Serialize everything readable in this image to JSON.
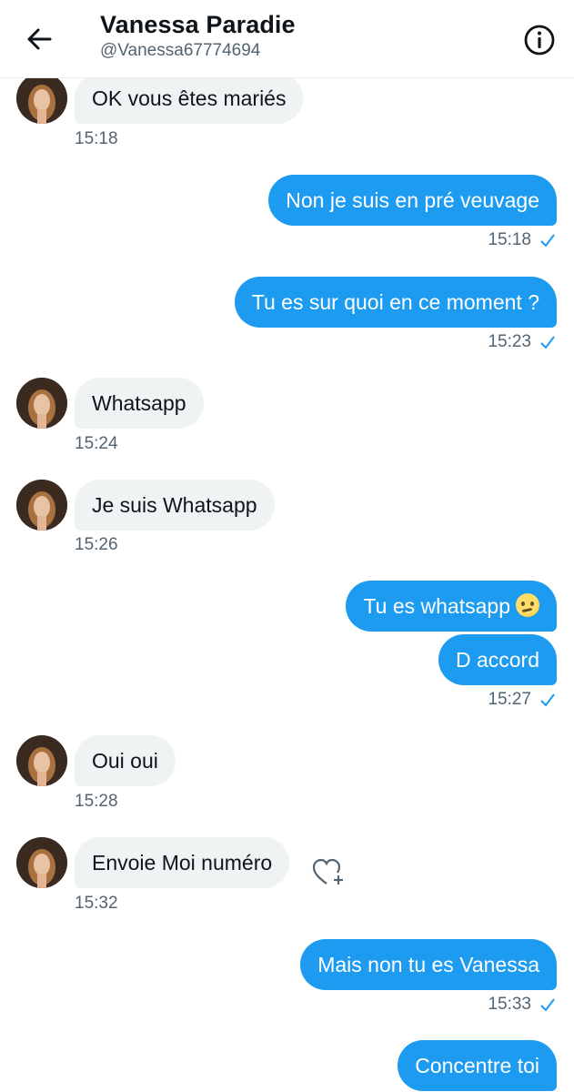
{
  "header": {
    "name": "Vanessa Paradie",
    "handle": "@Vanessa67774694",
    "back_icon": "arrow-left-icon",
    "info_icon": "info-circle-icon"
  },
  "colors": {
    "accent": "#1d9bf0",
    "incoming_bubble": "#eff3f4",
    "muted_text": "#536471"
  },
  "messages": [
    {
      "direction": "in",
      "text": "OK vous êtes mariés",
      "time": "15:18"
    },
    {
      "direction": "out",
      "text": "Non je suis en pré veuvage",
      "time": "15:18",
      "status_icon": "check-icon"
    },
    {
      "direction": "out",
      "text": "Tu es sur quoi en ce moment ?",
      "time": "15:23",
      "status_icon": "check-icon"
    },
    {
      "direction": "in",
      "text": "Whatsapp",
      "time": "15:24"
    },
    {
      "direction": "in",
      "text": "Je suis Whatsapp",
      "time": "15:26"
    },
    {
      "direction": "out",
      "text": "Tu es whatsapp",
      "emoji": "thinking-face-emoji"
    },
    {
      "direction": "out",
      "text": "D accord",
      "time": "15:27",
      "status_icon": "check-icon"
    },
    {
      "direction": "in",
      "text": "Oui oui",
      "time": "15:28"
    },
    {
      "direction": "in",
      "text": "Envoie Moi numéro",
      "time": "15:32",
      "reaction_icon": "heart-plus-icon"
    },
    {
      "direction": "out",
      "text": "Mais non tu es Vanessa",
      "time": "15:33",
      "status_icon": "check-icon"
    },
    {
      "direction": "out",
      "text": "Concentre toi"
    }
  ]
}
